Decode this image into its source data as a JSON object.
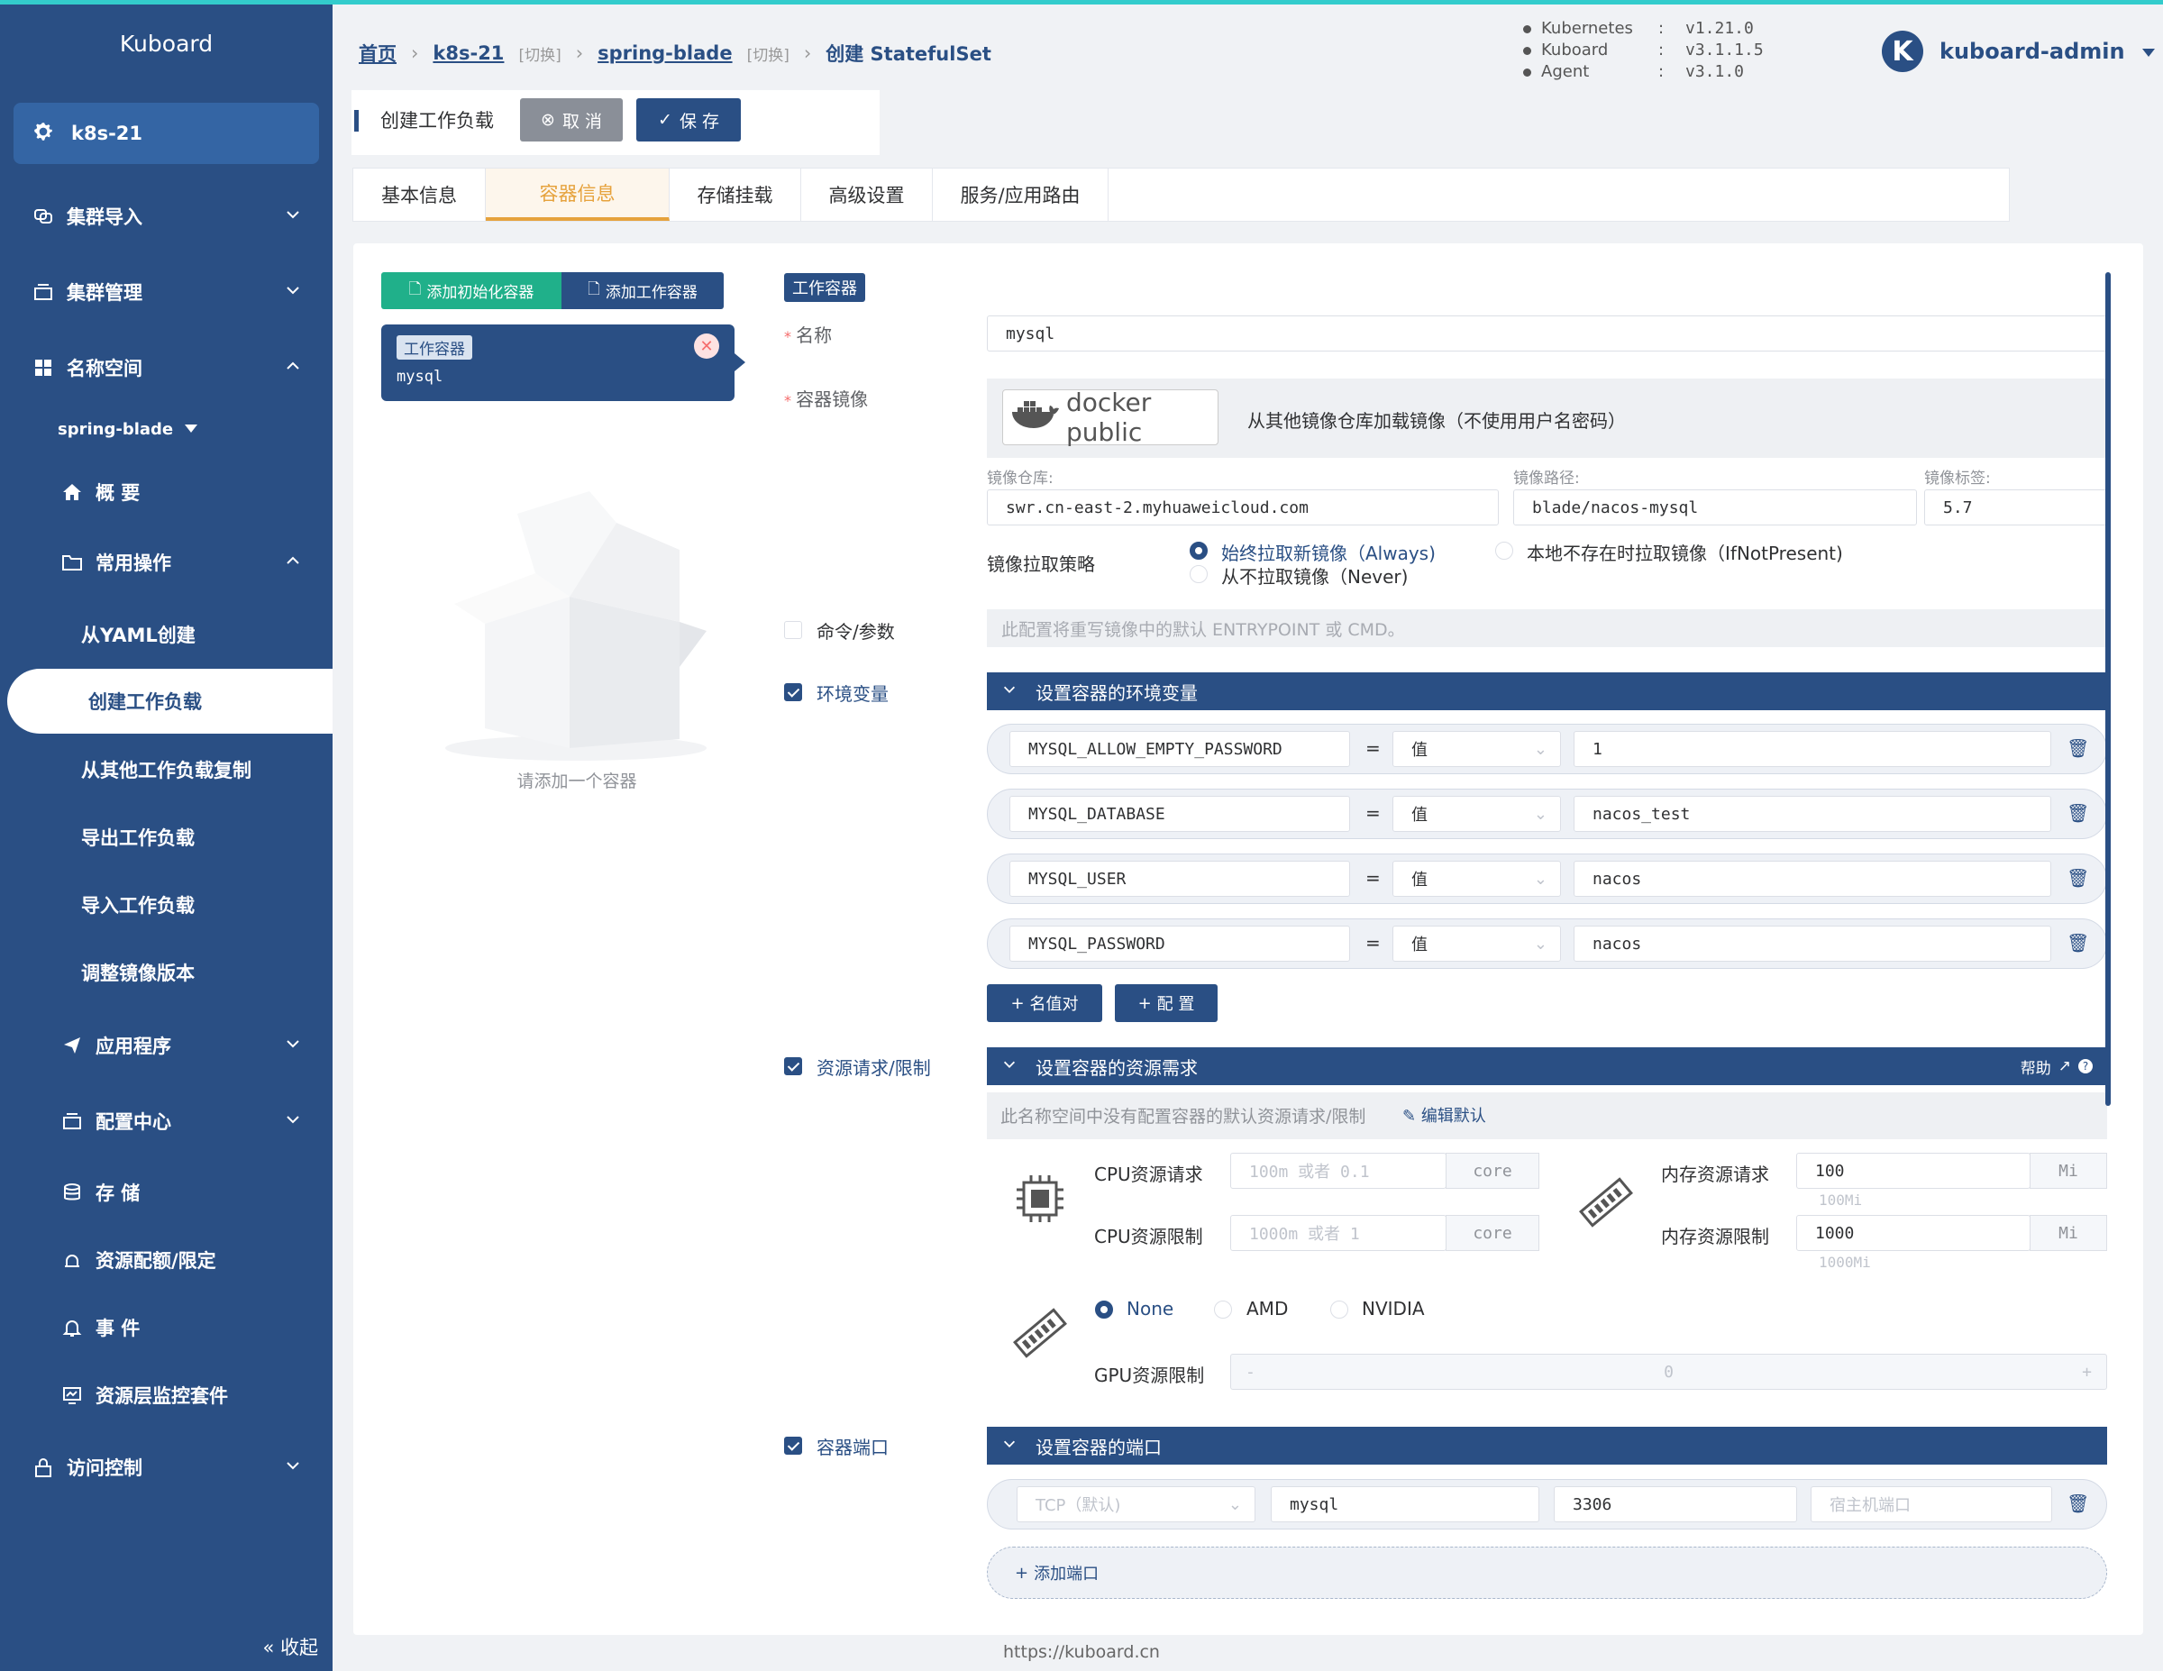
{
  "app": {
    "name": "Kuboard",
    "footer_url": "https://kuboard.cn"
  },
  "sidebar": {
    "cluster": "k8s-21",
    "namespace": "spring-blade",
    "items": [
      {
        "label": "集群导入",
        "icon": "cluster-import-icon"
      },
      {
        "label": "集群管理",
        "icon": "cluster-manage-icon"
      },
      {
        "label": "名称空间",
        "icon": "grid-icon"
      },
      {
        "label": "概 要",
        "icon": "home-icon"
      },
      {
        "label": "常用操作",
        "icon": "folder-icon"
      },
      {
        "label": "从YAML创建"
      },
      {
        "label": "创建工作负载"
      },
      {
        "label": "从其他工作负载复制"
      },
      {
        "label": "导出工作负载"
      },
      {
        "label": "导入工作负载"
      },
      {
        "label": "调整镜像版本"
      },
      {
        "label": "应用程序",
        "icon": "send-icon"
      },
      {
        "label": "配置中心",
        "icon": "config-icon"
      },
      {
        "label": "存 储",
        "icon": "database-icon"
      },
      {
        "label": "资源配额/限定",
        "icon": "quota-icon"
      },
      {
        "label": "事 件",
        "icon": "bell-icon"
      },
      {
        "label": "资源层监控套件",
        "icon": "monitor-icon"
      },
      {
        "label": "访问控制",
        "icon": "lock-icon"
      }
    ],
    "collapse_label": "收起"
  },
  "breadcrumb": {
    "home": "首页",
    "cluster": "k8s-21",
    "switch1": "[切换]",
    "namespace": "spring-blade",
    "switch2": "[切换]",
    "current": "创建 StatefulSet"
  },
  "versions": [
    {
      "name": "Kubernetes",
      "value": "v1.21.0"
    },
    {
      "name": "Kuboard",
      "value": "v3.1.1.5"
    },
    {
      "name": "Agent",
      "value": "v3.1.0"
    }
  ],
  "user": {
    "avatar_letter": "K",
    "name": "kuboard-admin"
  },
  "titlebar": {
    "title": "创建工作负载",
    "cancel": "取 消",
    "save": "保 存"
  },
  "tabs": [
    "基本信息",
    "容器信息",
    "存储挂载",
    "高级设置",
    "服务/应用路由"
  ],
  "left_panel": {
    "add_init": "添加初始化容器",
    "add_work": "添加工作容器",
    "card_tag": "工作容器",
    "card_name": "mysql",
    "empty_text": "请添加一个容器"
  },
  "form": {
    "section_tag": "工作容器",
    "name_label": "名称",
    "name_value": "mysql",
    "image_label": "容器镜像",
    "docker_logo": "docker public",
    "image_desc": "从其他镜像仓库加载镜像（不使用用户名密码）",
    "repo_label": "镜像仓库:",
    "repo_value": "swr.cn-east-2.myhuaweicloud.com",
    "path_label": "镜像路径:",
    "path_value": "blade/nacos-mysql",
    "tag_label": "镜像标签:",
    "tag_value": "5.7",
    "pull_label": "镜像拉取策略",
    "pull_always": "始终拉取新镜像（Always)",
    "pull_ifnot": "本地不存在时拉取镜像（IfNotPresent)",
    "pull_never": "从不拉取镜像（Never)",
    "cmd_label": "命令/参数",
    "cmd_hint": "此配置将重写镜像中的默认 ENTRYPOINT 或 CMD。",
    "env_label": "环境变量",
    "env_head": "设置容器的环境变量",
    "env": [
      {
        "name": "MYSQL_ALLOW_EMPTY_PASSWORD",
        "eq": "=",
        "type": "值",
        "value": "1"
      },
      {
        "name": "MYSQL_DATABASE",
        "eq": "=",
        "type": "值",
        "value": "nacos_test"
      },
      {
        "name": "MYSQL_USER",
        "eq": "=",
        "type": "值",
        "value": "nacos"
      },
      {
        "name": "MYSQL_PASSWORD",
        "eq": "=",
        "type": "值",
        "value": "nacos"
      }
    ],
    "btn_kv": "名值对",
    "btn_cfg": "配 置",
    "res_label": "资源请求/限制",
    "res_head": "设置容器的资源需求",
    "res_help": "帮助",
    "res_note": "此名称空间中没有配置容器的默认资源请求/限制",
    "res_edit": "编辑默认",
    "cpu_req_label": "CPU资源请求",
    "cpu_req_ph": "100m 或者 0.1",
    "cpu_lim_label": "CPU资源限制",
    "cpu_lim_ph": "1000m 或者 1",
    "cpu_unit": "core",
    "mem_req_label": "内存资源请求",
    "mem_req_value": "100",
    "mem_req_hint": "100Mi",
    "mem_lim_label": "内存资源限制",
    "mem_lim_value": "1000",
    "mem_lim_hint": "1000Mi",
    "mem_unit": "Mi",
    "gpu_none": "None",
    "gpu_amd": "AMD",
    "gpu_nvidia": "NVIDIA",
    "gpu_label": "GPU资源限制",
    "gpu_value": "0",
    "gpu_minus": "-",
    "gpu_plus": "+",
    "port_label": "容器端口",
    "port_head": "设置容器的端口",
    "port_proto": "TCP（默认)",
    "port_name": "mysql",
    "port_num": "3306",
    "port_host_ph": "宿主机端口",
    "add_port": "添加端口"
  },
  "colors": {
    "primary": "#2a4f84",
    "accent_tab": "#e6a23c",
    "green": "#20b08a",
    "danger": "#f56c6c"
  }
}
